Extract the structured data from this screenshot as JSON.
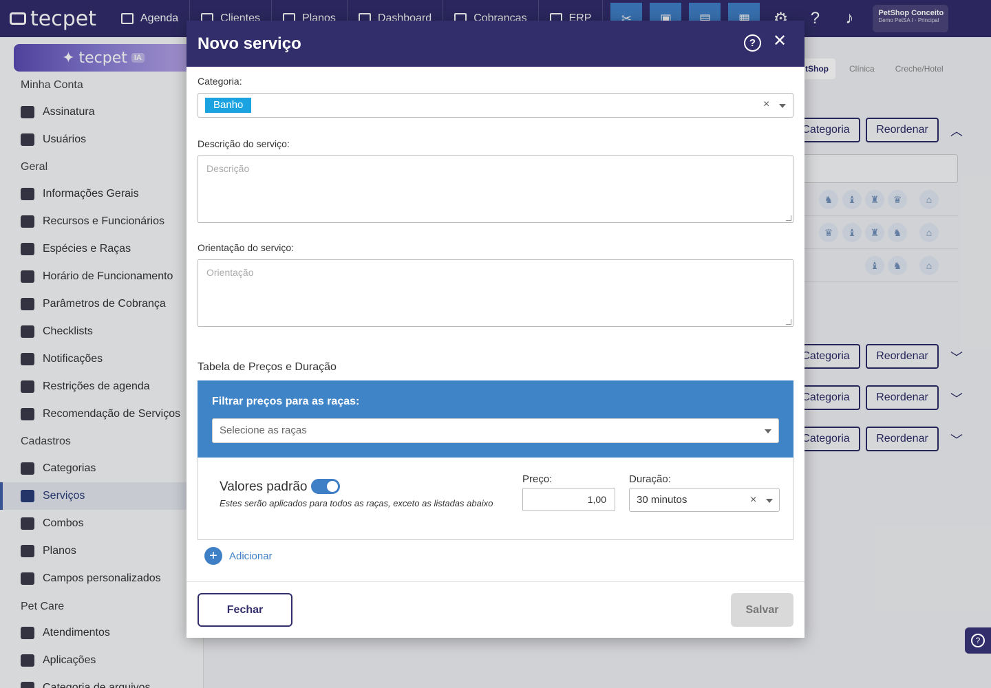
{
  "app": {
    "logo": "tecpet",
    "ia_logo": "tecpet",
    "ia_badge": "IA"
  },
  "topnav": {
    "items": [
      "Agenda",
      "Clientes",
      "Planos",
      "Dashboard",
      "Cobranças",
      "ERP"
    ],
    "user_name": "PetShop Conceito",
    "user_sub": "Demo PetSA I · Principal"
  },
  "sidebar": {
    "sections": {
      "minha_conta": "Minha Conta",
      "geral": "Geral",
      "cadastros": "Cadastros",
      "pet_care": "Pet Care"
    },
    "items": {
      "assinatura": "Assinatura",
      "usuarios": "Usuários",
      "informacoes": "Informações Gerais",
      "recursos": "Recursos e Funcionários",
      "especies": "Espécies e Raças",
      "horario": "Horário de Funcionamento",
      "parametros": "Parâmetros de Cobrança",
      "checklists": "Checklists",
      "notificacoes": "Notificações",
      "restricoes": "Restrições de agenda",
      "recomendacao": "Recomendação de Serviços",
      "categorias": "Categorias",
      "servicos": "Serviços",
      "combos": "Combos",
      "planos": "Planos",
      "campos": "Campos personalizados",
      "atendimentos": "Atendimentos",
      "aplicacoes": "Aplicações",
      "categoria_arquivos": "Categoria de arquivos"
    }
  },
  "background": {
    "tabs": [
      "tShop",
      "Clínica",
      "Creche/Hotel"
    ],
    "categoria_btn": "Categoria",
    "reordenar_btn": "Reordenar"
  },
  "modal": {
    "title": "Novo serviço",
    "categoria_label": "Categoria:",
    "categoria_value": "Banho",
    "descricao_label": "Descrição do serviço:",
    "descricao_placeholder": "Descrição",
    "orientacao_label": "Orientação do serviço:",
    "orientacao_placeholder": "Orientação",
    "tabela_title": "Tabela de Preços e Duração",
    "filtrar_title": "Filtrar preços para as raças:",
    "racas_placeholder": "Selecione as raças",
    "valores_padrao": "Valores padrão",
    "valores_sub": "Estes serão aplicados para todos as raças, exceto as listadas abaixo",
    "preco_label": "Preço:",
    "preco_value": "1,00",
    "duracao_label": "Duração:",
    "duracao_value": "30 minutos",
    "adicionar": "Adicionar",
    "fechar": "Fechar",
    "salvar": "Salvar"
  }
}
